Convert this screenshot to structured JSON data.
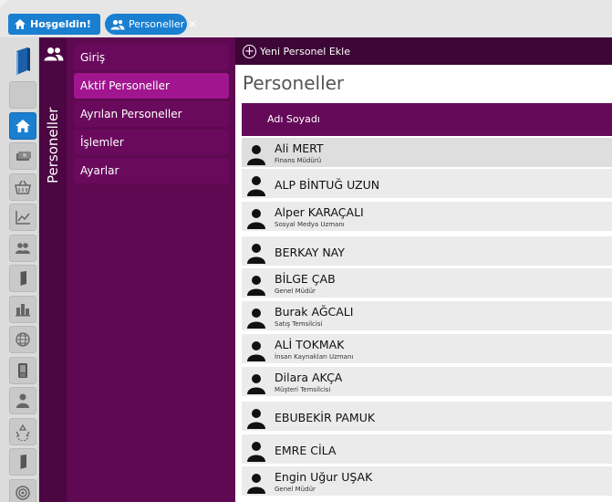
{
  "tabs": [
    {
      "label": "Hoşgeldin!"
    },
    {
      "label": "Personeller",
      "close": "×"
    }
  ],
  "rail": {
    "icons": [
      "book-icon",
      "home-icon",
      "money-icon",
      "basket-icon",
      "chart-icon",
      "people-icon",
      "notebook-icon",
      "buildings-icon",
      "globe-icon",
      "device-icon",
      "person-icon",
      "recycle-icon",
      "notebook-icon",
      "target-icon"
    ],
    "active_index": 1
  },
  "section": {
    "title": "Personeller"
  },
  "submenu": {
    "items": [
      {
        "label": "Giriş"
      },
      {
        "label": "Aktif Personeller"
      },
      {
        "label": "Ayrılan Personeller"
      },
      {
        "label": "İşlemler"
      },
      {
        "label": "Ayarlar"
      }
    ],
    "active_index": 1
  },
  "toolbar": {
    "add_label": "Yeni Personel Ekle"
  },
  "page": {
    "title": "Personeller"
  },
  "table": {
    "header": "Adı Soyadı",
    "rows": [
      {
        "name": "Ali MERT",
        "role": "Finans Müdürü"
      },
      {
        "name": "ALP BİNTUĞ UZUN",
        "role": ""
      },
      {
        "name": "Alper KARAÇALI",
        "role": "Sosyal Medya Uzmanı"
      },
      {
        "name": "BERKAY NAY",
        "role": ""
      },
      {
        "name": "BİLGE ÇAB",
        "role": "Genel Müdür"
      },
      {
        "name": "Burak AĞCALI",
        "role": "Satış Temsilcisi"
      },
      {
        "name": "ALİ TOKMAK",
        "role": "İnsan Kaynakları Uzmanı"
      },
      {
        "name": "Dilara AKÇA",
        "role": "Müşteri Temsilcisi"
      },
      {
        "name": "EBUBEKİR PAMUK",
        "role": ""
      },
      {
        "name": "EMRE CİLA",
        "role": ""
      },
      {
        "name": "Engin Uğur UŞAK",
        "role": "Genel Müdür"
      }
    ],
    "selected_index": 0
  },
  "colors": {
    "accent_blue": "#1b7fd0",
    "purple_dark": "#3d0636",
    "purple": "#5e0951",
    "purple_active": "#a1158e"
  }
}
